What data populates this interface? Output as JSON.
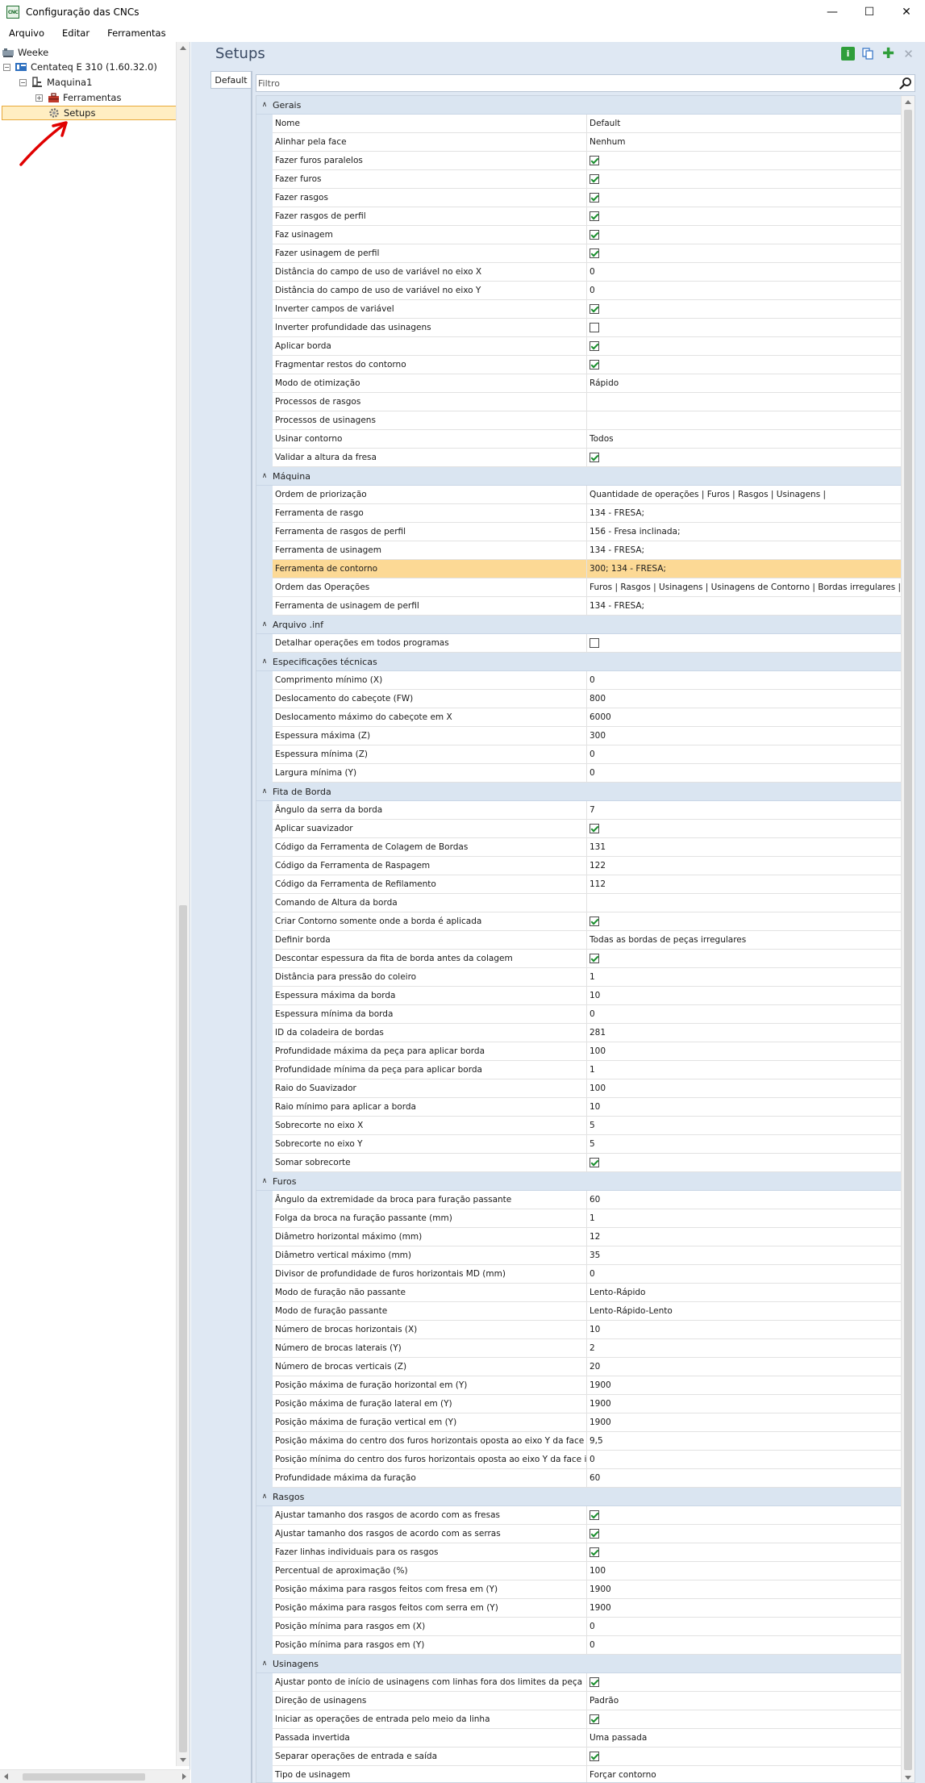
{
  "window": {
    "title": "Configuração das CNCs",
    "app_icon": "CNC",
    "minimize": "—",
    "maximize": "☐",
    "close": "✕"
  },
  "menu": [
    "Arquivo",
    "Editar",
    "Ferramentas"
  ],
  "tree": {
    "root": "Weeke",
    "machine": "Centateq E 310 (1.60.32.0)",
    "subnode": "Maquina1",
    "tools": "Ferramentas",
    "setups": "Setups"
  },
  "panel": {
    "title": "Setups",
    "tab": "Default",
    "filter_placeholder": "Filtro",
    "icons": [
      "info-icon",
      "copy-icon",
      "add-icon",
      "close-icon"
    ]
  },
  "categories": [
    {
      "label": "Gerais",
      "rows": [
        {
          "name": "Nome",
          "value": "Default"
        },
        {
          "name": "Alinhar pela face",
          "value": "Nenhum"
        },
        {
          "name": "Fazer furos paralelos",
          "check": true
        },
        {
          "name": "Fazer furos",
          "check": true
        },
        {
          "name": "Fazer rasgos",
          "check": true
        },
        {
          "name": "Fazer rasgos de perfil",
          "check": true
        },
        {
          "name": "Faz usinagem",
          "check": true
        },
        {
          "name": "Fazer usinagem de perfil",
          "check": true
        },
        {
          "name": "Distância do campo de uso de variável no eixo X",
          "value": "0"
        },
        {
          "name": "Distância do campo de uso de variável no eixo Y",
          "value": "0"
        },
        {
          "name": "Inverter campos de variável",
          "check": true
        },
        {
          "name": "Inverter profundidade das usinagens",
          "check": false
        },
        {
          "name": "Aplicar borda",
          "check": true
        },
        {
          "name": "Fragmentar restos do contorno",
          "check": true
        },
        {
          "name": "Modo de otimização",
          "value": "Rápido"
        },
        {
          "name": "Processos de rasgos",
          "value": ""
        },
        {
          "name": "Processos de usinagens",
          "value": ""
        },
        {
          "name": "Usinar contorno",
          "value": "Todos"
        },
        {
          "name": "Validar a altura da fresa",
          "check": true
        }
      ]
    },
    {
      "label": "Máquina",
      "rows": [
        {
          "name": "Ordem de priorização",
          "value": "Quantidade de operações | Furos | Rasgos | Usinagens |"
        },
        {
          "name": "Ferramenta de rasgo",
          "value": "134 - FRESA;"
        },
        {
          "name": "Ferramenta de rasgos de perfil",
          "value": "156 - Fresa inclinada;"
        },
        {
          "name": "Ferramenta de usinagem",
          "value": "134 - FRESA;"
        },
        {
          "name": "Ferramenta de contorno",
          "value": "300; 134 - FRESA;",
          "highlight": true
        },
        {
          "name": "Ordem das Operações",
          "value": "Furos | Rasgos | Usinagens | Usinagens de Contorno | Bordas irregulares | Bor"
        },
        {
          "name": "Ferramenta de usinagem de perfil",
          "value": "134 - FRESA;"
        }
      ]
    },
    {
      "label": "Arquivo .inf",
      "rows": [
        {
          "name": "Detalhar operações em todos programas",
          "check": false
        }
      ]
    },
    {
      "label": "Especificações técnicas",
      "rows": [
        {
          "name": "Comprimento mínimo (X)",
          "value": "0"
        },
        {
          "name": "Deslocamento do cabeçote (FW)",
          "value": "800"
        },
        {
          "name": "Deslocamento máximo do cabeçote em X",
          "value": "6000"
        },
        {
          "name": "Espessura máxima (Z)",
          "value": "300"
        },
        {
          "name": "Espessura mínima (Z)",
          "value": "0"
        },
        {
          "name": "Largura mínima (Y)",
          "value": "0"
        }
      ]
    },
    {
      "label": "Fita de Borda",
      "rows": [
        {
          "name": "Ângulo da serra da borda",
          "value": "7"
        },
        {
          "name": "Aplicar suavizador",
          "check": true
        },
        {
          "name": "Código da Ferramenta de Colagem de Bordas",
          "value": "131"
        },
        {
          "name": "Código da Ferramenta de Raspagem",
          "value": "122"
        },
        {
          "name": "Código da Ferramenta de Refilamento",
          "value": "112"
        },
        {
          "name": "Comando de Altura da borda",
          "value": ""
        },
        {
          "name": "Criar Contorno somente onde a borda é aplicada",
          "check": true
        },
        {
          "name": "Definir borda",
          "value": "Todas as bordas de peças irregulares"
        },
        {
          "name": "Descontar espessura da fita de borda antes da colagem",
          "check": true
        },
        {
          "name": "Distância para pressão do coleiro",
          "value": "1"
        },
        {
          "name": "Espessura máxima da borda",
          "value": "10"
        },
        {
          "name": "Espessura mínima da borda",
          "value": "0"
        },
        {
          "name": "ID da coladeira de bordas",
          "value": "281"
        },
        {
          "name": "Profundidade máxima da peça para aplicar borda",
          "value": "100"
        },
        {
          "name": "Profundidade mínima da peça para aplicar borda",
          "value": "1"
        },
        {
          "name": "Raio do Suavizador",
          "value": "100"
        },
        {
          "name": "Raio mínimo para aplicar a borda",
          "value": "10"
        },
        {
          "name": "Sobrecorte no eixo X",
          "value": "5"
        },
        {
          "name": "Sobrecorte no eixo Y",
          "value": "5"
        },
        {
          "name": "Somar sobrecorte",
          "check": true
        }
      ]
    },
    {
      "label": "Furos",
      "rows": [
        {
          "name": "Ângulo da extremidade da broca para furação passante",
          "value": "60"
        },
        {
          "name": "Folga da broca na furação passante (mm)",
          "value": "1"
        },
        {
          "name": "Diâmetro horizontal máximo (mm)",
          "value": "12"
        },
        {
          "name": "Diâmetro vertical máximo (mm)",
          "value": "35"
        },
        {
          "name": "Divisor de profundidade de furos horizontais MD (mm)",
          "value": "0"
        },
        {
          "name": "Modo de furação não passante",
          "value": "Lento-Rápido"
        },
        {
          "name": "Modo de furação passante",
          "value": "Lento-Rápido-Lento"
        },
        {
          "name": "Número de brocas horizontais (X)",
          "value": "10"
        },
        {
          "name": "Número de brocas laterais (Y)",
          "value": "2"
        },
        {
          "name": "Número de brocas verticais (Z)",
          "value": "20"
        },
        {
          "name": "Posição máxima de furação horizontal em (Y)",
          "value": "1900"
        },
        {
          "name": "Posição máxima de furação lateral em (Y)",
          "value": "1900"
        },
        {
          "name": "Posição máxima de furação vertical em (Y)",
          "value": "1900"
        },
        {
          "name": "Posição máxima do centro dos furos horizontais oposta ao eixo Y da face in...",
          "value": "9,5"
        },
        {
          "name": "Posição mínima do centro dos furos horizontais oposta ao eixo Y da face in...",
          "value": "0"
        },
        {
          "name": "Profundidade máxima da furação",
          "value": "60"
        }
      ]
    },
    {
      "label": "Rasgos",
      "rows": [
        {
          "name": "Ajustar tamanho dos rasgos de acordo com as fresas",
          "check": true
        },
        {
          "name": "Ajustar tamanho dos rasgos de acordo com as serras",
          "check": true
        },
        {
          "name": "Fazer linhas individuais para os rasgos",
          "check": true
        },
        {
          "name": "Percentual de aproximação (%)",
          "value": "100"
        },
        {
          "name": "Posição máxima para rasgos feitos com fresa em (Y)",
          "value": "1900"
        },
        {
          "name": "Posição máxima para rasgos feitos com serra em (Y)",
          "value": "1900"
        },
        {
          "name": "Posição mínima para rasgos em (X)",
          "value": "0"
        },
        {
          "name": "Posição mínima para rasgos em (Y)",
          "value": "0"
        }
      ]
    },
    {
      "label": "Usinagens",
      "rows": [
        {
          "name": "Ajustar ponto de início de usinagens com linhas fora dos limites da peça",
          "check": true
        },
        {
          "name": "Direção de usinagens",
          "value": "Padrão"
        },
        {
          "name": "Iniciar as operações de entrada pelo meio da linha",
          "check": true
        },
        {
          "name": "Passada invertida",
          "value": "Uma passada"
        },
        {
          "name": "Separar operações de entrada e saída",
          "check": true
        },
        {
          "name": "Tipo de usinagem",
          "value": "Forçar contorno"
        }
      ]
    }
  ],
  "colors": {
    "accent_highlight": "#fcd995",
    "category_bg": "#dae5f1",
    "panel_bg": "#dfe8f3",
    "check_color": "#1a8f2e",
    "annotation_arrow": "#e00000"
  }
}
